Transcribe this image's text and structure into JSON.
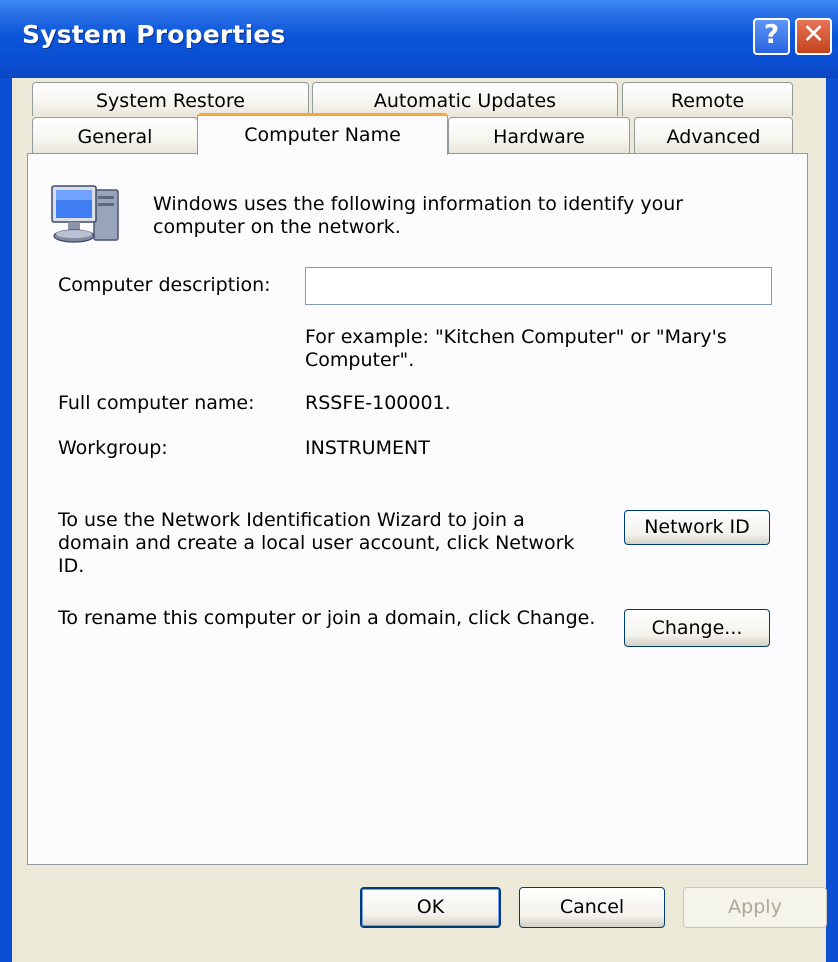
{
  "window": {
    "title": "System Properties",
    "help_button": "?",
    "close_button": "✕"
  },
  "tabs": {
    "row1": [
      "System Restore",
      "Automatic Updates",
      "Remote"
    ],
    "row2": [
      "General",
      "Computer Name",
      "Hardware",
      "Advanced"
    ],
    "active": "Computer Name"
  },
  "panel": {
    "intro_text": "Windows uses the following information to identify your computer on the network.",
    "description_label": "Computer description:",
    "description_value": "",
    "example_text": "For example: \"Kitchen Computer\" or \"Mary's Computer\".",
    "full_name_label": "Full computer name:",
    "full_name_value": "RSSFE-100001.",
    "workgroup_label": "Workgroup:",
    "workgroup_value": "INSTRUMENT",
    "network_id_text": "To use the Network Identification Wizard to join a domain and create a local user account, click Network ID.",
    "network_id_button": "Network ID",
    "rename_text": "To rename this computer or join a domain, click Change.",
    "change_button": "Change..."
  },
  "footer": {
    "ok_button": "OK",
    "cancel_button": "Cancel",
    "apply_button": "Apply"
  },
  "icons": {
    "computer": "computer-network-icon"
  }
}
